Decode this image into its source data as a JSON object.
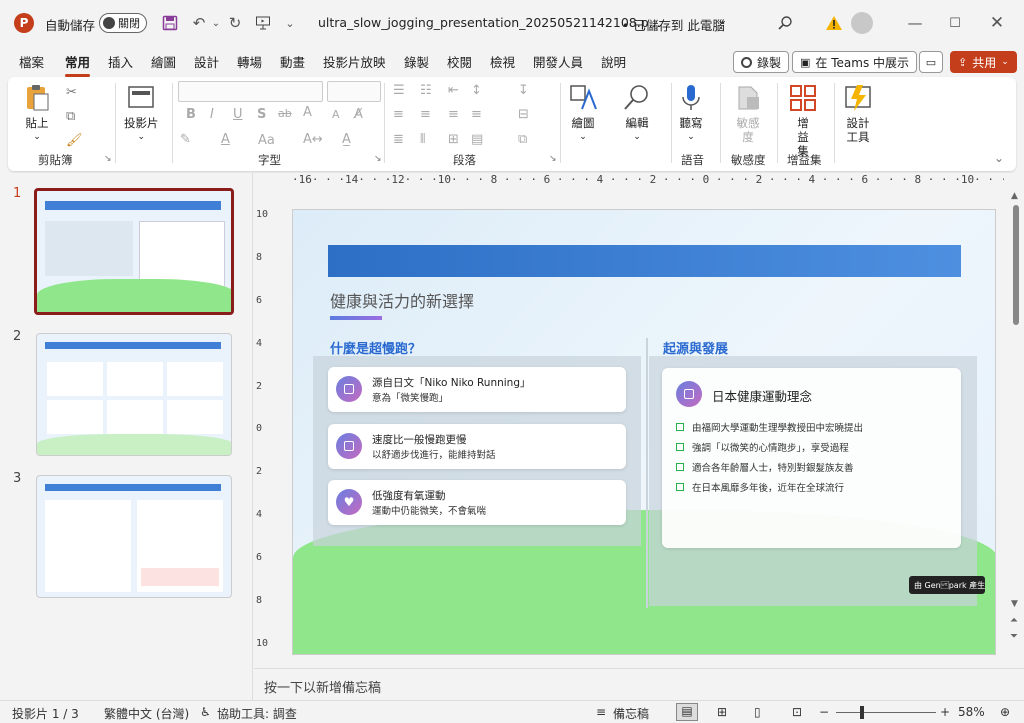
{
  "titlebar": {
    "autosave_label": "自動儲存",
    "autosave_state": "關閉",
    "filename": "ultra_slow_jogging_presentation_20250521142108.p...",
    "save_status": "• 已儲存到 此電腦",
    "save_chevron": "⌄"
  },
  "menu_tabs": [
    "檔案",
    "常用",
    "插入",
    "繪圖",
    "設計",
    "轉場",
    "動畫",
    "投影片放映",
    "錄製",
    "校閱",
    "檢視",
    "開發人員",
    "說明"
  ],
  "active_tab": "常用",
  "header_buttons": {
    "record": "錄製",
    "teams": "在 Teams 中展示",
    "share": "共用"
  },
  "ribbon": {
    "paste": "貼上",
    "clipboard_group": "剪貼簿",
    "slides_btn": "投影片",
    "font_group": "字型",
    "font_size_up": "A",
    "paragraph_group": "段落",
    "drawing_btn": "繪圖",
    "editing_btn": "編輯",
    "dictate_btn": "聽寫",
    "voice_group": "語音",
    "sensitivity_btn": "敏感度",
    "sensitivity_group": "敏感度",
    "addins_btn": "增益集",
    "addins_group": "增益集",
    "designer_btn": "設計工具",
    "font_buttons": [
      "B",
      "I",
      "U",
      "S",
      "ab",
      "A",
      "Aa"
    ]
  },
  "slides": [
    {
      "num": "1",
      "selected": true
    },
    {
      "num": "2",
      "selected": false
    },
    {
      "num": "3",
      "selected": false
    }
  ],
  "ruler": {
    "horizontal": "·16· · ·14· · ·12· · ·10· · · 8 · · · 6 · · · 4 · · · 2 · · · 0 · · · 2 · · · 4 · · · 6 · · · 8 · · ·10· · ·12· · ·14· · ·16·",
    "vertical": [
      "10",
      "8",
      "6",
      "4",
      "2",
      "0",
      "2",
      "4",
      "6",
      "8",
      "10"
    ]
  },
  "slide": {
    "title": "健康與活力的新選擇",
    "left_heading": "什麼是超慢跑？",
    "right_heading": "起源與發展",
    "cards": [
      {
        "line1": "源自日文「Niko Niko Running」",
        "line2": "意為「微笑慢跑」"
      },
      {
        "line1": "速度比一般慢跑更慢",
        "line2": "以舒適步伐進行，能維持對話"
      },
      {
        "line1": "低強度有氧運動",
        "line2": "運動中仍能微笑，不會氣喘"
      }
    ],
    "right_card_title": "日本健康運動理念",
    "right_list": [
      "由福岡大學運動生理學教授田中宏曉提出",
      "強調「以微笑的心情跑步」，享受過程",
      "適合各年齡層人士，特別對銀髮族友善",
      "在日本風靡多年後，近年在全球流行"
    ],
    "badge": "由 Gen\u000bpark 產生"
  },
  "notes_placeholder": "按一下以新增備忘稿",
  "status": {
    "slide_counter": "投影片 1 / 3",
    "language": "繁體中文 (台灣)",
    "accessibility": "協助工具: 調查",
    "notes": "備忘稿",
    "zoom": "58%"
  },
  "colors": {
    "accent": "#c43e1c",
    "slide_blue": "#2a6ad0",
    "green": "#90e68a"
  }
}
